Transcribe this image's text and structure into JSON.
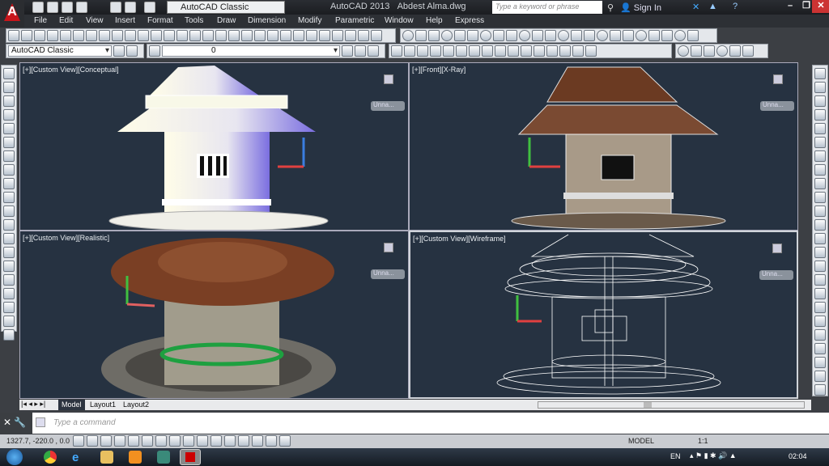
{
  "app": {
    "title": "AutoCAD 2013",
    "file": "Abdest Alma.dwg",
    "workspace": "AutoCAD Classic",
    "search_placeholder": "Type a keyword or phrase",
    "sign_in": "Sign In"
  },
  "menu": [
    "File",
    "Edit",
    "View",
    "Insert",
    "Format",
    "Tools",
    "Draw",
    "Dimension",
    "Modify",
    "Parametric",
    "Window",
    "Help",
    "Express"
  ],
  "toolbar2": {
    "workspace": "AutoCAD Classic",
    "layer": "0"
  },
  "viewports": [
    {
      "label": "[+][Custom View][Conceptual]",
      "viewcube": "Unna..."
    },
    {
      "label": "[+][Front][X-Ray]",
      "viewcube": "Unna..."
    },
    {
      "label": "[+][Custom View][Realistic]",
      "viewcube": "Unna..."
    },
    {
      "label": "[+][Custom View][Wireframe]",
      "viewcube": "Unna..."
    }
  ],
  "layout_tabs": [
    "Model",
    "Layout1",
    "Layout2"
  ],
  "command": {
    "placeholder": "Type a command"
  },
  "status": {
    "coords": "1327.7, -220.0 , 0.0",
    "model": "MODEL",
    "scale": "1:1"
  },
  "taskbar": {
    "lang": "EN",
    "time": "02:04"
  },
  "colors": {
    "viewport_bg": "#263241",
    "accent": "#c8151b"
  }
}
